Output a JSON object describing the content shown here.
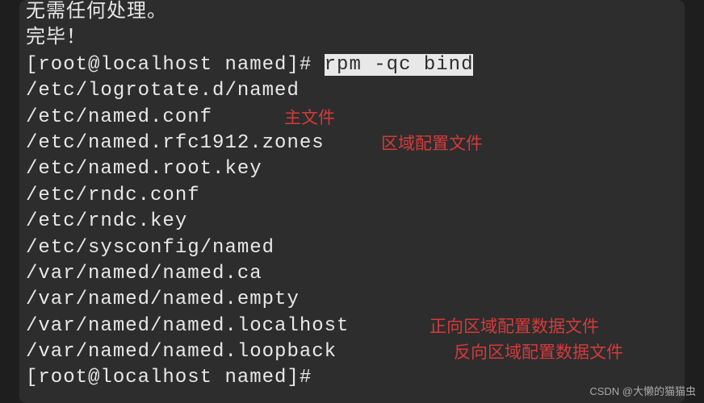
{
  "terminal": {
    "partial_top_line": "无需任何处理。",
    "done_line": "完毕！",
    "prompt1": "[root@localhost named]# ",
    "command": "rpm -qc bind",
    "output": [
      "/etc/logrotate.d/named",
      "/etc/named.conf",
      "/etc/named.rfc1912.zones",
      "/etc/named.root.key",
      "/etc/rndc.conf",
      "/etc/rndc.key",
      "/etc/sysconfig/named",
      "/var/named/named.ca",
      "/var/named/named.empty",
      "/var/named/named.localhost",
      "/var/named/named.loopback"
    ],
    "prompt2": "[root@localhost named]#"
  },
  "annotations": {
    "main_file": "主文件",
    "zone_config": "区域配置文件",
    "forward_zone": "正向区域配置数据文件",
    "reverse_zone": "反向区域配置数据文件"
  },
  "watermark": "CSDN @大懒的猫猫虫"
}
